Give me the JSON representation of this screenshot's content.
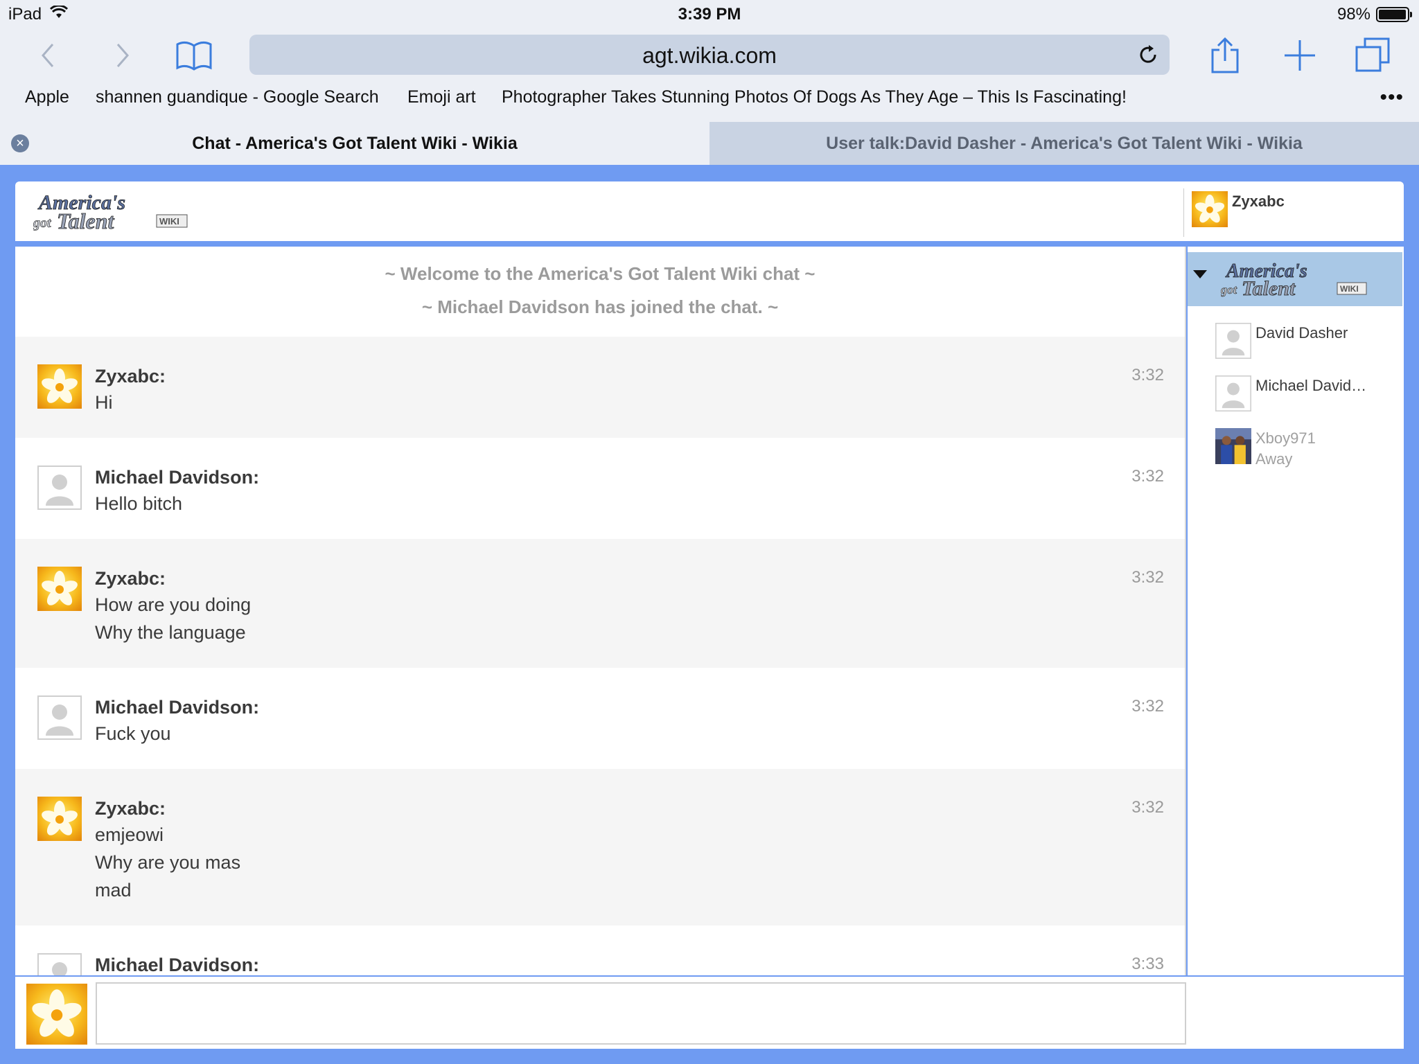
{
  "status_bar": {
    "device": "iPad",
    "time": "3:39 PM",
    "battery": "98%"
  },
  "browser": {
    "url": "agt.wikia.com",
    "favorites": [
      "Apple",
      "shannen guandique - Google Search",
      "Emoji art",
      "Photographer Takes Stunning Photos Of Dogs As They Age – This Is Fascinating!"
    ],
    "more_label": "•••",
    "tabs": [
      {
        "title": "Chat - America's Got Talent Wiki - Wikia",
        "active": true
      },
      {
        "title": "User talk:David Dasher - America's Got Talent Wiki - Wikia",
        "active": false
      }
    ],
    "close_symbol": "×"
  },
  "logo_text": {
    "line1": "America's",
    "line2": "got",
    "line3": "Talent",
    "badge": "WIKI"
  },
  "current_user": {
    "name": "Zyxabc"
  },
  "chat": {
    "system_messages": [
      "~ Welcome to the America's Got Talent Wiki chat ~",
      "~ Michael Davidson has joined the chat. ~"
    ],
    "messages": [
      {
        "user": "Zyxabc:",
        "time": "3:32",
        "lines": [
          "Hi"
        ],
        "avatar": "flower"
      },
      {
        "user": "Michael Davidson:",
        "time": "3:32",
        "lines": [
          "Hello bitch"
        ],
        "avatar": "default"
      },
      {
        "user": "Zyxabc:",
        "time": "3:32",
        "lines": [
          "How are you doing",
          "Why the language"
        ],
        "avatar": "flower"
      },
      {
        "user": "Michael Davidson:",
        "time": "3:32",
        "lines": [
          "Fuck you"
        ],
        "avatar": "default"
      },
      {
        "user": "Zyxabc:",
        "time": "3:32",
        "lines": [
          "emjeowi",
          "Why are you mas",
          "mad"
        ],
        "avatar": "flower"
      },
      {
        "user": "Michael Davidson:",
        "time": "3:33",
        "lines": [],
        "avatar": "default"
      }
    ]
  },
  "user_list": [
    {
      "name": "David Dasher",
      "status": "",
      "avatar": "default",
      "away": false
    },
    {
      "name": "Michael David…",
      "status": "",
      "avatar": "default",
      "away": false
    },
    {
      "name": "Xboy971",
      "status": "Away",
      "avatar": "photo",
      "away": true
    }
  ],
  "composer": {
    "value": "",
    "placeholder": ""
  },
  "colors": {
    "page_bg": "#6f9bf2",
    "alt_row": "#f5f5f5",
    "muted_text": "#9b9b9b"
  }
}
